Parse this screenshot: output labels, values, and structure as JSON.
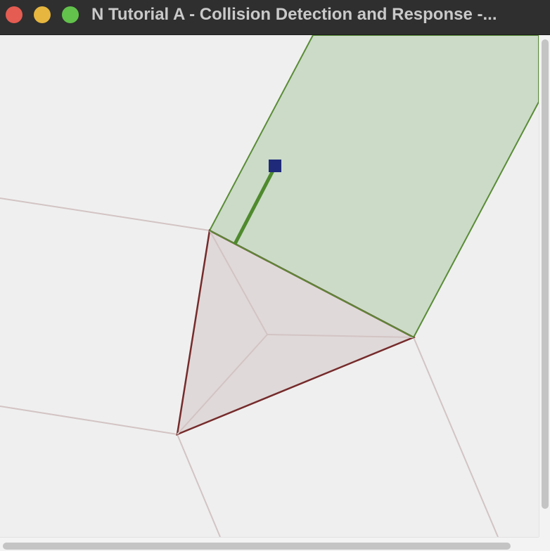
{
  "window": {
    "title": "N Tutorial A - Collision Detection and Response -..."
  },
  "traffic_lights": {
    "close_color": "#e45c52",
    "minimize_color": "#e6b63e",
    "zoom_color": "#62c24c"
  },
  "scene": {
    "colors": {
      "background": "#efefef",
      "region_line": "#d3c4c4",
      "triangle_fill": "#e0d9d9",
      "triangle_edge": "#762b2b",
      "projection_fill": "#cbdbc8",
      "projection_edge": "#5a8c36",
      "point": "#1f2a7a",
      "penetration_vector": "#4f8a2e"
    }
  }
}
